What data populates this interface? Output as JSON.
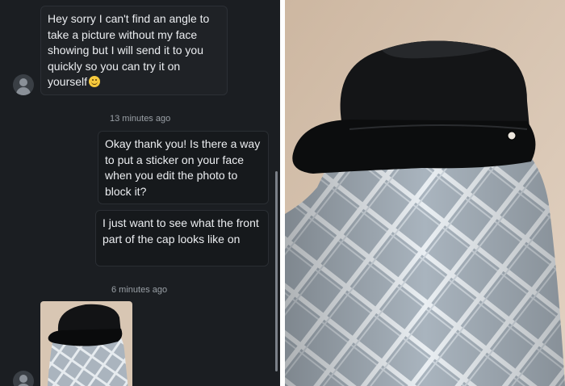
{
  "conversation": {
    "messages": [
      {
        "sender": "them",
        "text": "Hey sorry I can't find an angle to take a picture without my face showing but I will send it to you quickly so you can try it on yourself",
        "emoji": "smiling-face"
      },
      {
        "sender": "me",
        "text": "Okay thank you! Is there a way to put a sticker on your face when you edit the photo to block it?"
      },
      {
        "sender": "me",
        "text": "I just want to see what the front part of the cap looks like on"
      }
    ],
    "timestamps": [
      "13 minutes ago",
      "6 minutes ago"
    ],
    "attachment": {
      "icon": "photo-thumbnail"
    }
  },
  "colors": {
    "chat_background": "#1b1e22",
    "bubble_border": "#2c3036",
    "text": "#eceef1",
    "timestamp": "#9aa0a6",
    "cap": "#111214",
    "cloth": "#a8b3bd",
    "wall": "#d9c7b5"
  }
}
